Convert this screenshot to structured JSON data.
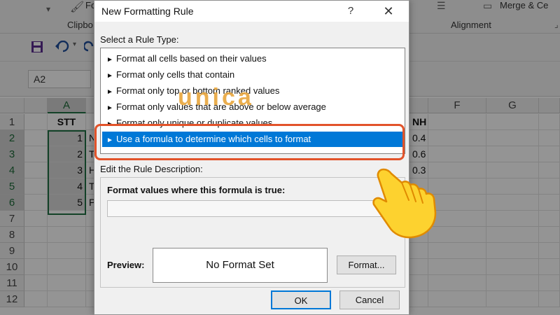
{
  "ribbon": {
    "clipboard_group": "Clipbo",
    "format_painter_label": "Fo",
    "alignment_group": "Alignment",
    "merge_label": "Merge & Ce"
  },
  "namebox": {
    "value": "A2"
  },
  "sheet": {
    "columns": [
      "A",
      "F",
      "G"
    ],
    "rows": [
      "1",
      "2",
      "3",
      "4",
      "5",
      "6",
      "7",
      "8",
      "9",
      "10",
      "11",
      "12"
    ],
    "col_a": [
      "STT",
      "1",
      "2",
      "3",
      "4",
      "5"
    ],
    "col_b": [
      "",
      "N",
      "T",
      "H",
      "T",
      "P"
    ],
    "col_e": [
      "NH",
      "0.4",
      "0.6",
      "0.3"
    ]
  },
  "dialog": {
    "title": "New Formatting Rule",
    "help": "?",
    "close": "✕",
    "select_rule_type_label": "Select a Rule Type:",
    "rule_types": [
      "Format all cells based on their values",
      "Format only cells that contain",
      "Format only top or bottom ranked values",
      "Format only values that are above or below average",
      "Format only unique or duplicate values",
      "Use a formula to determine which cells to format"
    ],
    "selected_rule_index": 5,
    "edit_rule_label": "Edit the Rule Description:",
    "formula_label": "Format values where this formula is true:",
    "formula_value": "",
    "preview_label": "Preview:",
    "preview_text": "No Format Set",
    "format_button": "Format...",
    "ok_button": "OK",
    "cancel_button": "Cancel"
  },
  "watermark": {
    "text": "unica"
  },
  "colors": {
    "selection_blue": "#0078d7",
    "highlight_outline": "#e2532a",
    "excel_green": "#217346",
    "watermark_orange": "#f08a1c"
  },
  "icons": [
    "format-painter-icon",
    "save-icon",
    "undo-icon",
    "redo-icon",
    "pointer-hand-icon",
    "arrow-icon"
  ]
}
